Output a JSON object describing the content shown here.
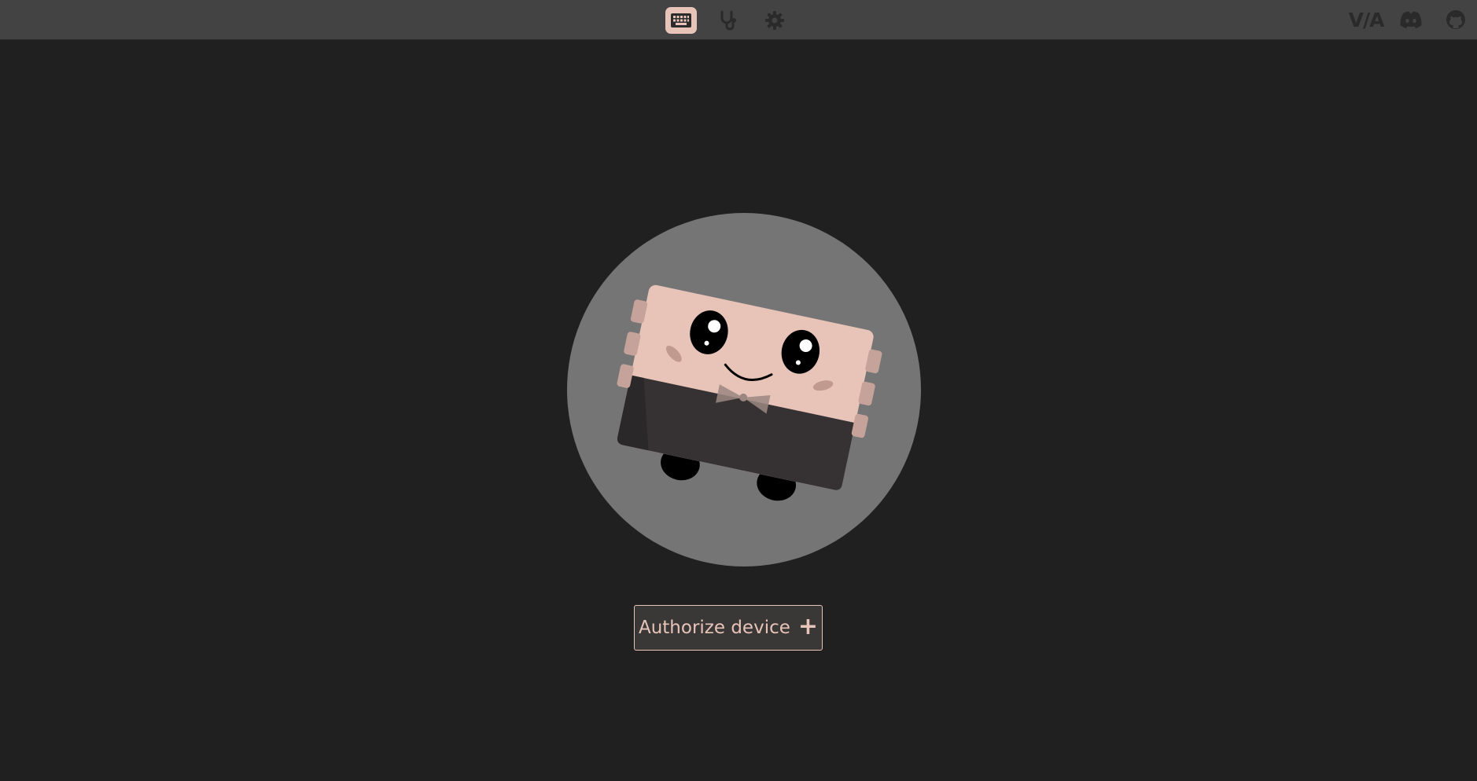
{
  "nav": {
    "items": [
      {
        "icon": "keyboard-icon",
        "active": true
      },
      {
        "icon": "stethoscope-icon",
        "active": false
      },
      {
        "icon": "gear-icon",
        "active": false
      }
    ]
  },
  "links": {
    "via_logo": "V/A",
    "discord_icon": "discord-icon",
    "github_icon": "github-icon"
  },
  "main": {
    "authorize_label": "Authorize device",
    "authorize_symbol": "+"
  },
  "colors": {
    "accent": "#e8c4b8",
    "topbar": "#434343",
    "background": "#202020",
    "mascot_circle": "#757575"
  }
}
